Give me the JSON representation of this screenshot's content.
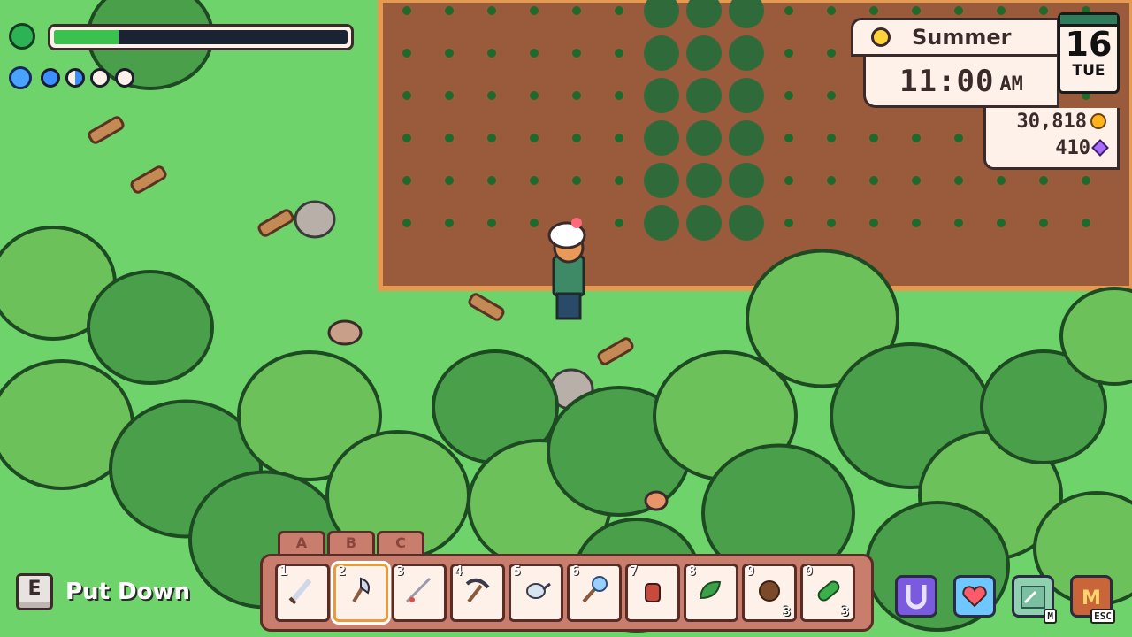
{
  "stamina": {
    "fill_fraction": 0.22
  },
  "mana": {
    "orbs": [
      "full",
      "half",
      "empty",
      "empty"
    ]
  },
  "clock": {
    "season": "Summer",
    "time": "11:00",
    "ampm": "AM"
  },
  "calendar": {
    "day": "16",
    "weekday": "TUE"
  },
  "money": {
    "gold": "30,818",
    "essence": "410"
  },
  "prompt": {
    "key": "E",
    "action": "Put Down"
  },
  "hotbar": {
    "tabs": [
      "A",
      "B",
      "C"
    ],
    "slots": [
      {
        "num": "1",
        "item": "sword-icon",
        "qty": ""
      },
      {
        "num": "2",
        "item": "axe-icon",
        "qty": ""
      },
      {
        "num": "3",
        "item": "fishing-rod-icon",
        "qty": ""
      },
      {
        "num": "4",
        "item": "pickaxe-icon",
        "qty": ""
      },
      {
        "num": "5",
        "item": "watering-can-icon",
        "qty": ""
      },
      {
        "num": "6",
        "item": "net-icon",
        "qty": ""
      },
      {
        "num": "7",
        "item": "figurine-icon",
        "qty": ""
      },
      {
        "num": "8",
        "item": "leaf-icon",
        "qty": ""
      },
      {
        "num": "9",
        "item": "seed-icon",
        "qty": "3"
      },
      {
        "num": "0",
        "item": "cucumber-icon",
        "qty": "3"
      }
    ],
    "selected": "2"
  },
  "side_buttons": [
    {
      "name": "horseshoe-icon",
      "label": ""
    },
    {
      "name": "heart-icon",
      "label": ""
    },
    {
      "name": "map-icon",
      "label": "M"
    },
    {
      "name": "menu-icon",
      "label": "ESC"
    }
  ],
  "colors": {
    "grass": "#6fd36b",
    "soil": "#9a5a3c",
    "ui_panel": "#fdf1e9",
    "hotbar": "#c97d6d"
  }
}
